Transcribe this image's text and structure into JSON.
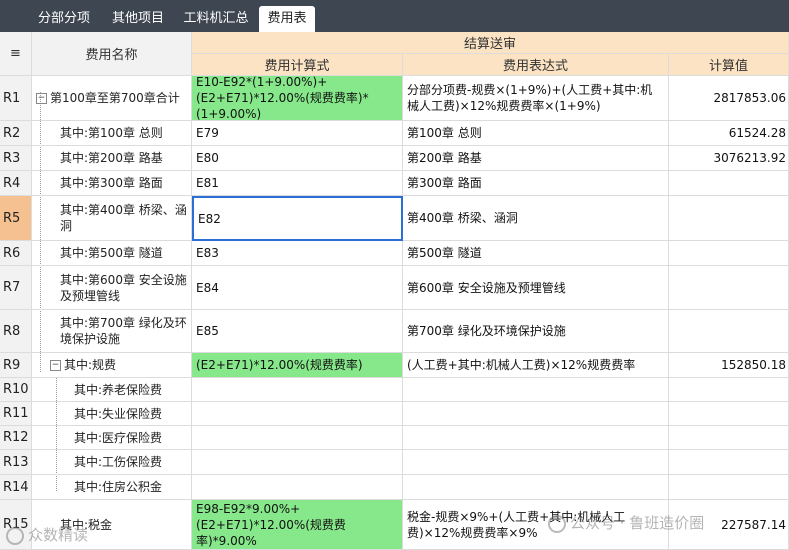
{
  "tabs": [
    {
      "label": "分部分项",
      "active": false
    },
    {
      "label": "其他项目",
      "active": false
    },
    {
      "label": "工料机汇总",
      "active": false
    },
    {
      "label": "费用表",
      "active": true
    }
  ],
  "header": {
    "menu_icon": "≡",
    "name_col": "费用名称",
    "group": "结算送审",
    "formula_col": "费用计算式",
    "expr_col": "费用表达式",
    "value_col": "计算值"
  },
  "rows": [
    {
      "id": "R1",
      "name": "第100章至第700章合计",
      "formula": "E10-E92*(1+9.00%)+(E2+E71)*12.00%(规费费率)*(1+9.00%)",
      "expr": "分部分项费-规费×(1+9%)+(人工费+其中:机械人工费)×12%规费费率×(1+9%)",
      "value": "2817853.06"
    },
    {
      "id": "R2",
      "name": "其中:第100章 总则",
      "formula": "E79",
      "expr": "第100章 总则",
      "value": "61524.28"
    },
    {
      "id": "R3",
      "name": "其中:第200章 路基",
      "formula": "E80",
      "expr": "第200章 路基",
      "value": "3076213.92"
    },
    {
      "id": "R4",
      "name": "其中:第300章 路面",
      "formula": "E81",
      "expr": "第300章 路面",
      "value": ""
    },
    {
      "id": "R5",
      "name": "其中:第400章 桥梁、涵洞",
      "formula": "E82",
      "expr": "第400章 桥梁、涵洞",
      "value": ""
    },
    {
      "id": "R6",
      "name": "其中:第500章 隧道",
      "formula": "E83",
      "expr": "第500章 隧道",
      "value": ""
    },
    {
      "id": "R7",
      "name": "其中:第600章 安全设施及预埋管线",
      "formula": "E84",
      "expr": "第600章 安全设施及预埋管线",
      "value": ""
    },
    {
      "id": "R8",
      "name": "其中:第700章 绿化及环境保护设施",
      "formula": "E85",
      "expr": "第700章 绿化及环境保护设施",
      "value": ""
    },
    {
      "id": "R9",
      "name": "其中:规费",
      "formula": "(E2+E71)*12.00%(规费费率)",
      "expr": "(人工费+其中:机械人工费)×12%规费费率",
      "value": "152850.18"
    },
    {
      "id": "R10",
      "name": "其中:养老保险费",
      "formula": "",
      "expr": "",
      "value": ""
    },
    {
      "id": "R11",
      "name": "其中:失业保险费",
      "formula": "",
      "expr": "",
      "value": ""
    },
    {
      "id": "R12",
      "name": "其中:医疗保险费",
      "formula": "",
      "expr": "",
      "value": ""
    },
    {
      "id": "R13",
      "name": "其中:工伤保险费",
      "formula": "",
      "expr": "",
      "value": ""
    },
    {
      "id": "R14",
      "name": "其中:住房公积金",
      "formula": "",
      "expr": "",
      "value": ""
    },
    {
      "id": "R15",
      "name": "其中:税金",
      "formula": "E98-E92*9.00%+(E2+E71)*12.00%(规费费率)*9.00%",
      "expr": "税金-规费×9%+(人工费+其中:机械人工费)×12%规费费率×9%",
      "value": "227587.14"
    }
  ],
  "watermark": {
    "left": "众数精读",
    "right": "公众号 · 鲁班造价圈"
  },
  "colors": {
    "green": "#86e88a",
    "selected_row": "#f5c190",
    "group_header": "#fbe3c4",
    "tabbar": "#3d4651",
    "selection_border": "#2a6fd6"
  }
}
